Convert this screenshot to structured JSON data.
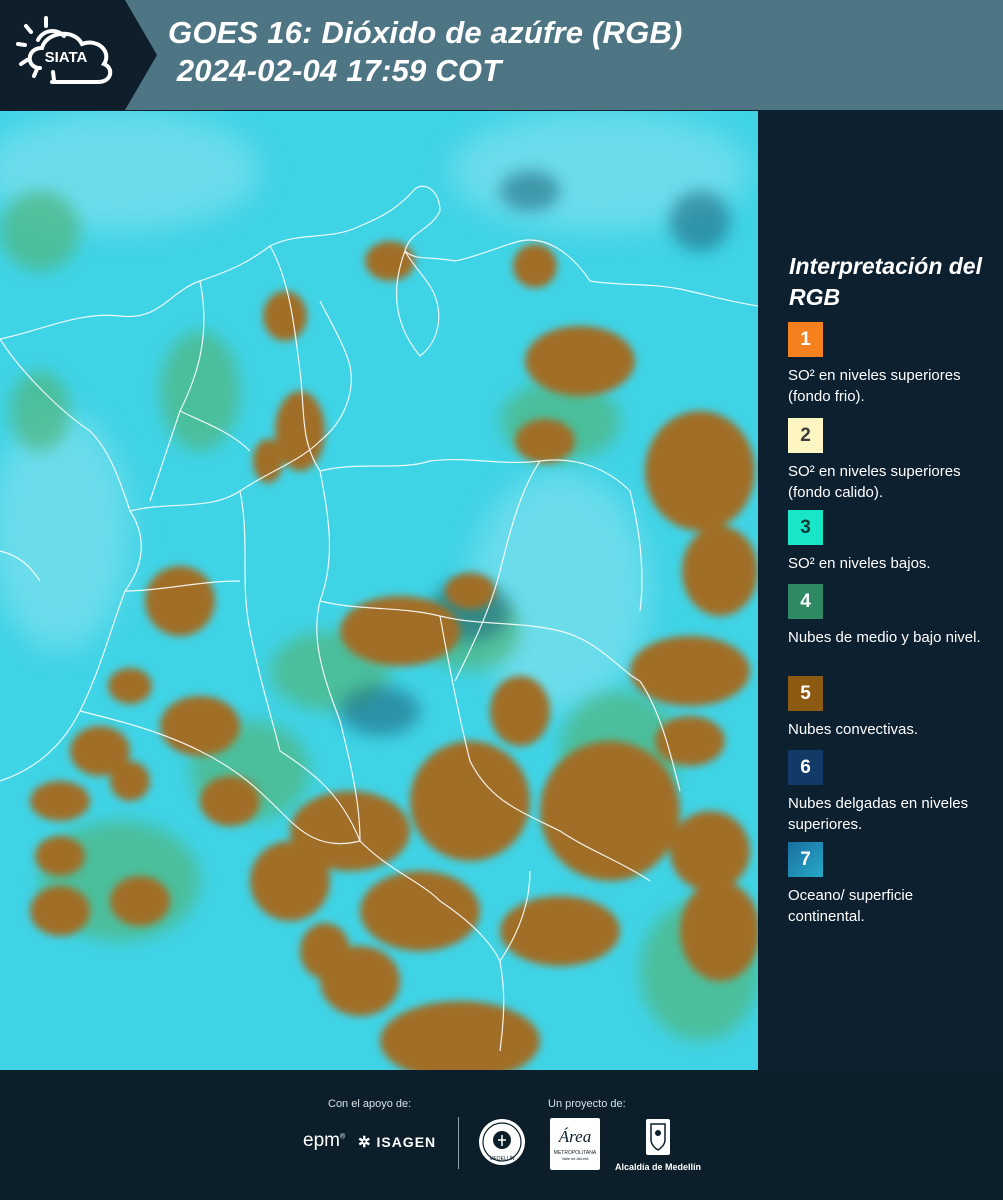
{
  "header": {
    "logo_text": "SIATA",
    "title_line1": "GOES 16: Dióxido de azúfre (RGB)",
    "title_line2": " 2024-02-04 17:59 COT"
  },
  "legend": {
    "title": "Interpretación del RGB",
    "items": [
      {
        "number": "1",
        "color": "#f5801e",
        "text_color": "#ffffff",
        "label": "SO² en niveles superiores (fondo frio)."
      },
      {
        "number": "2",
        "color": "#fdf6c3",
        "text_color": "#3d3d3d",
        "label": "SO² en niveles superiores (fondo calido)."
      },
      {
        "number": "3",
        "color": "#19e6c8",
        "text_color": "#0d3b36",
        "label": "SO² en niveles bajos."
      },
      {
        "number": "4",
        "color": "#2f8a63",
        "text_color": "#ffffff",
        "label": "Nubes de medio y bajo nivel."
      },
      {
        "number": "5",
        "color": "#8d5a12",
        "text_color": "#ffffff",
        "label": "Nubes convectivas."
      },
      {
        "number": "6",
        "color": "#123a66",
        "text_color": "#ffffff",
        "label": "Nubes delgadas en niveles superiores."
      },
      {
        "number": "7",
        "color": "#1e86ae",
        "text_color": "#ffffff",
        "label": "Oceano/ superficie continental."
      }
    ]
  },
  "map": {
    "ocean_color": "#3fd3e6",
    "cloud_color": "#a06e28",
    "boundary_color": "#ffffff"
  },
  "footer": {
    "support_label": "Con el apoyo de:",
    "project_label": "Un proyecto de:",
    "sponsor_epm": "epm",
    "sponsor_isagen": "ISAGEN",
    "area_name": "Área",
    "area_sub": "METROPOLITANA",
    "area_sub2": "Valle de Aburrá",
    "alcaldia": "Alcaldía de Medellín",
    "medellin_seal": "MEDELLÍN"
  }
}
